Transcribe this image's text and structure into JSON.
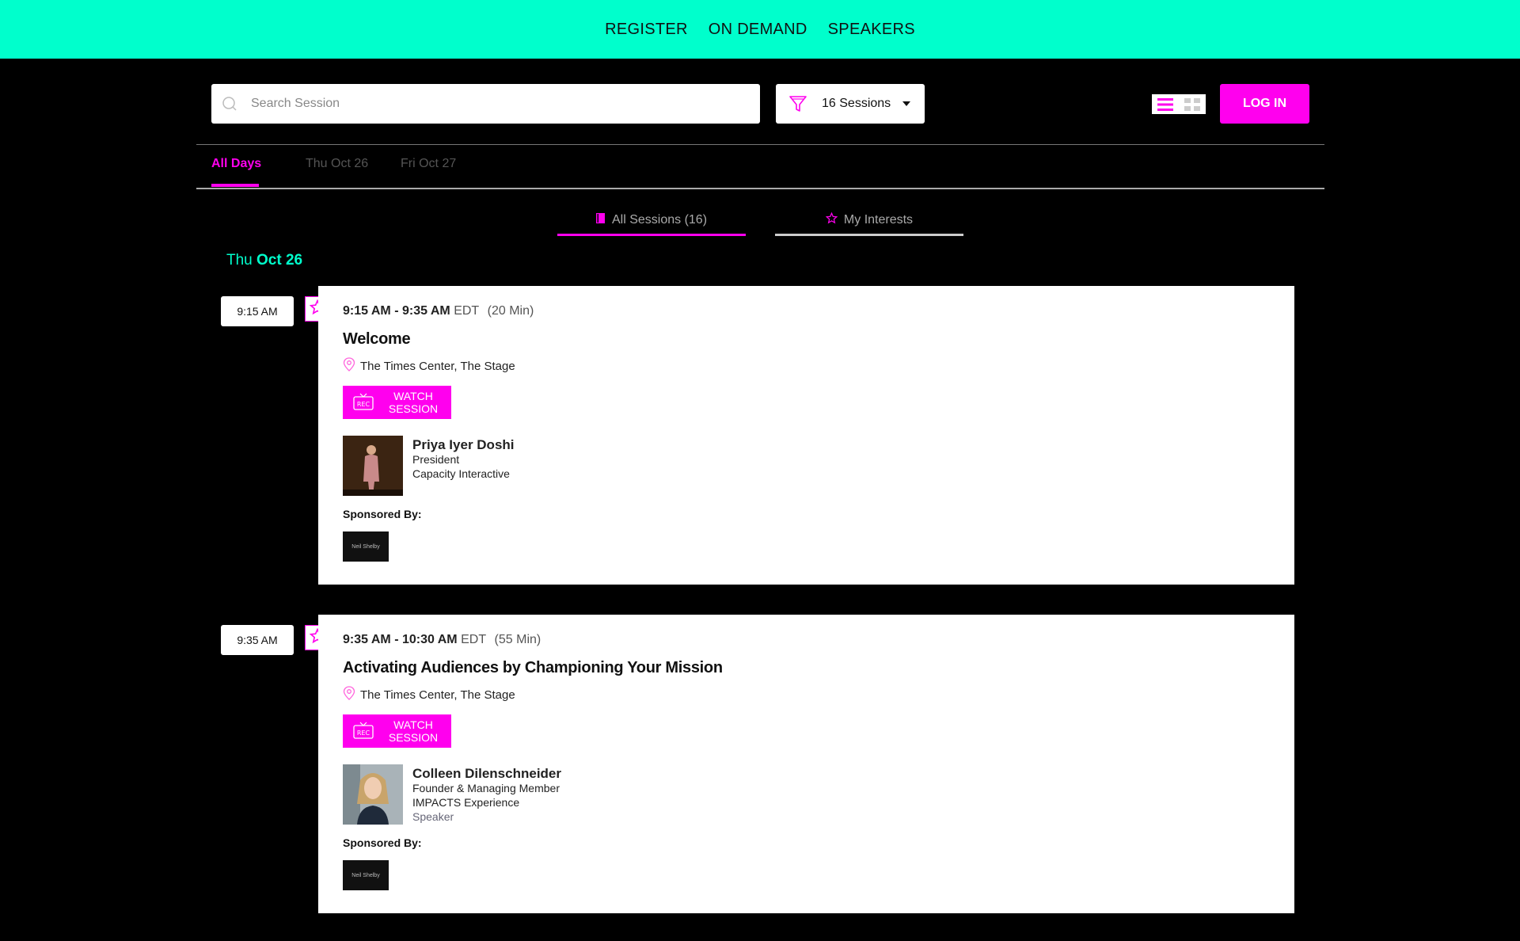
{
  "nav": {
    "register": "REGISTER",
    "on_demand": "ON DEMAND",
    "speakers": "SPEAKERS"
  },
  "search": {
    "placeholder": "Search Session",
    "value": ""
  },
  "filter": {
    "label": "16 Sessions"
  },
  "login": {
    "label": "LOG IN"
  },
  "day_tabs": [
    {
      "label": "All Days",
      "active": true
    },
    {
      "label": "Thu Oct 26",
      "active": false
    },
    {
      "label": "Fri Oct 27",
      "active": false
    }
  ],
  "sub_tabs": {
    "all_sessions": "All Sessions (16)",
    "my_interests": "My Interests"
  },
  "day_heading": {
    "weekday": "Thu",
    "date": "Oct 26"
  },
  "sessions": [
    {
      "chip_time": "9:15 AM",
      "time_range": "9:15 AM - 9:35 AM",
      "tz": "EDT",
      "duration": "(20 Min)",
      "title": "Welcome",
      "location": "The Times Center, The Stage",
      "watch_label": "WATCH SESSION",
      "speaker": {
        "name": "Priya Iyer Doshi",
        "role": "President",
        "org": "Capacity Interactive",
        "tag": ""
      },
      "sponsored_label": "Sponsored By:",
      "sponsor_logo_text": "Neil Shelby"
    },
    {
      "chip_time": "9:35 AM",
      "time_range": "9:35 AM - 10:30 AM",
      "tz": "EDT",
      "duration": "(55 Min)",
      "title": "Activating Audiences by Championing Your Mission",
      "location": "The Times Center, The Stage",
      "watch_label": "WATCH SESSION",
      "speaker": {
        "name": "Colleen Dilenschneider",
        "role": "Founder & Managing Member",
        "org": "IMPACTS Experience",
        "tag": "Speaker"
      },
      "sponsored_label": "Sponsored By:",
      "sponsor_logo_text": "Neil Shelby"
    }
  ],
  "rec_badge": "REC",
  "colors": {
    "accent": "#ff00ee",
    "nav_bg": "#00ffcc",
    "page_bg": "#000000"
  }
}
